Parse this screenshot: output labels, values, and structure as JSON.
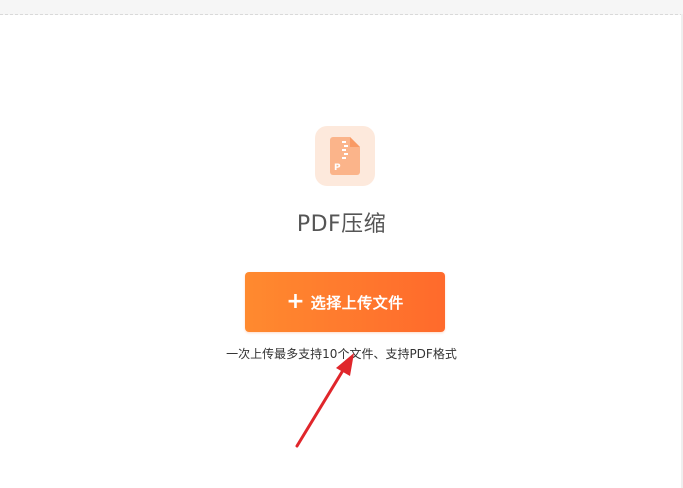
{
  "tool": {
    "title": "PDF压缩",
    "icon": "pdf-compress-icon",
    "icon_letter": "P"
  },
  "upload": {
    "plus_icon": "plus-icon",
    "plus_glyph": "+",
    "button_label": "选择上传文件",
    "hint": "一次上传最多支持10个文件、支持PDF格式"
  },
  "colors": {
    "accent": "#ff7a2e",
    "icon_bg": "#fde9dc",
    "icon_fg": "#fbb48a",
    "annotation": "#e0262b"
  }
}
